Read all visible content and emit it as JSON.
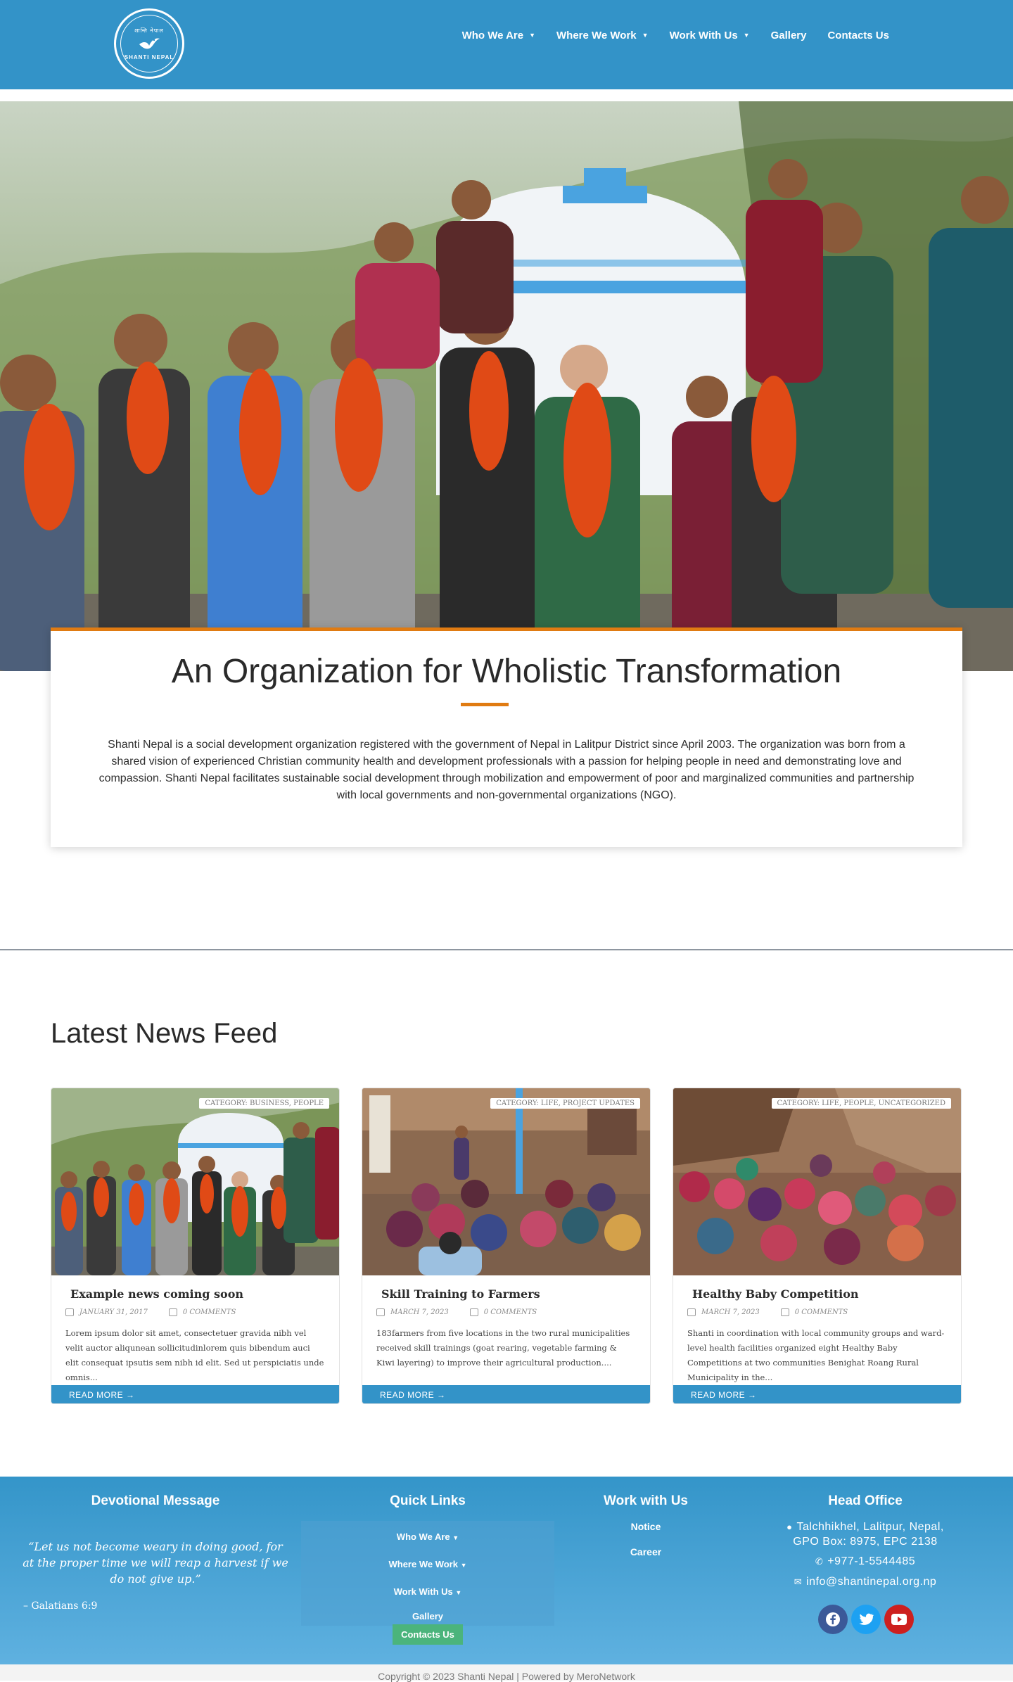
{
  "brand": {
    "logo_top_text": "शान्ति नेपाल",
    "logo_bottom_text": "SHANTI NEPAL"
  },
  "nav": [
    {
      "label": "Who We Are",
      "has_dropdown": true
    },
    {
      "label": "Where We Work",
      "has_dropdown": true
    },
    {
      "label": "Work With Us",
      "has_dropdown": true
    },
    {
      "label": "Gallery",
      "has_dropdown": false
    },
    {
      "label": "Contacts Us",
      "has_dropdown": false
    }
  ],
  "intro": {
    "title": "An Organization for Wholistic Transformation",
    "text": "Shanti Nepal is a social development organization registered with the government of Nepal in Lalitpur District since April 2003. The organization was born from a shared vision of experienced Christian community health and development professionals with a passion for helping people in need and demonstrating love and compassion. Shanti Nepal facilitates sustainable social development through mobilization and empowerment of poor and marginalized communities and partnership with local governments and non-governmental organizations (NGO)."
  },
  "news": {
    "heading": "Latest News Feed",
    "read_more": "READ MORE  →",
    "posts": [
      {
        "category": "CATEGORY: BUSINESS, PEOPLE",
        "title": "Example news coming soon",
        "date": "JANUARY 31, 2017",
        "comments": "0 COMMENTS",
        "excerpt": "Lorem ipsum dolor sit amet, consectetuer gravida nibh vel velit auctor aliqunean sollicitudinlorem quis bibendum auci elit consequat ipsutis sem nibh id elit. Sed ut perspiciatis unde omnis..."
      },
      {
        "category": "CATEGORY: LIFE, PROJECT UPDATES",
        "title": "Skill Training to Farmers",
        "date": "MARCH 7, 2023",
        "comments": "0 COMMENTS",
        "excerpt": "183farmers from five locations in the two rural municipalities received skill trainings (goat rearing, vegetable farming & Kiwi layering) to improve their agricultural production...."
      },
      {
        "category": "CATEGORY: LIFE, PEOPLE, UNCATEGORIZED",
        "title": "Healthy Baby Competition",
        "date": "MARCH 7, 2023",
        "comments": "0 COMMENTS",
        "excerpt": "Shanti in coordination with local community groups and ward-level health facilities organized eight Healthy Baby Competitions at two communities Benighat Roang Rural Municipality in the..."
      }
    ]
  },
  "footer": {
    "devotional": {
      "heading": "Devotional Message",
      "quote": "“Let us not become weary in doing good, for at the proper time we will reap a harvest if we do not give up.”",
      "citation": "– Galatians 6:9"
    },
    "quick_links": {
      "heading": "Quick Links",
      "items": [
        "Who We Are",
        "Where We Work",
        "Work With Us",
        "Gallery"
      ],
      "contact": "Contacts Us"
    },
    "work_with_us": {
      "heading": "Work with Us",
      "items": [
        "Notice",
        "Career"
      ]
    },
    "head_office": {
      "heading": "Head Office",
      "address_line1": "Talchhikhel, Lalitpur, Nepal,",
      "address_line2": "GPO Box: 8975, EPC 2138",
      "phone": "+977-1-5544485",
      "email": "info@shantinepal.org.np"
    },
    "social": [
      {
        "icon": "facebook-icon",
        "color": "#3b5998"
      },
      {
        "icon": "twitter-icon",
        "color": "#1da1f2"
      },
      {
        "icon": "youtube-icon",
        "color": "#cd201f"
      }
    ],
    "copyright": "Copyright © 2023 Shanti Nepal | Powered by MeroNetwork"
  },
  "colors": {
    "header": "#3393c8",
    "accent": "#e07b12",
    "button": "#3393c8",
    "contact_button": "#4bb47c"
  }
}
